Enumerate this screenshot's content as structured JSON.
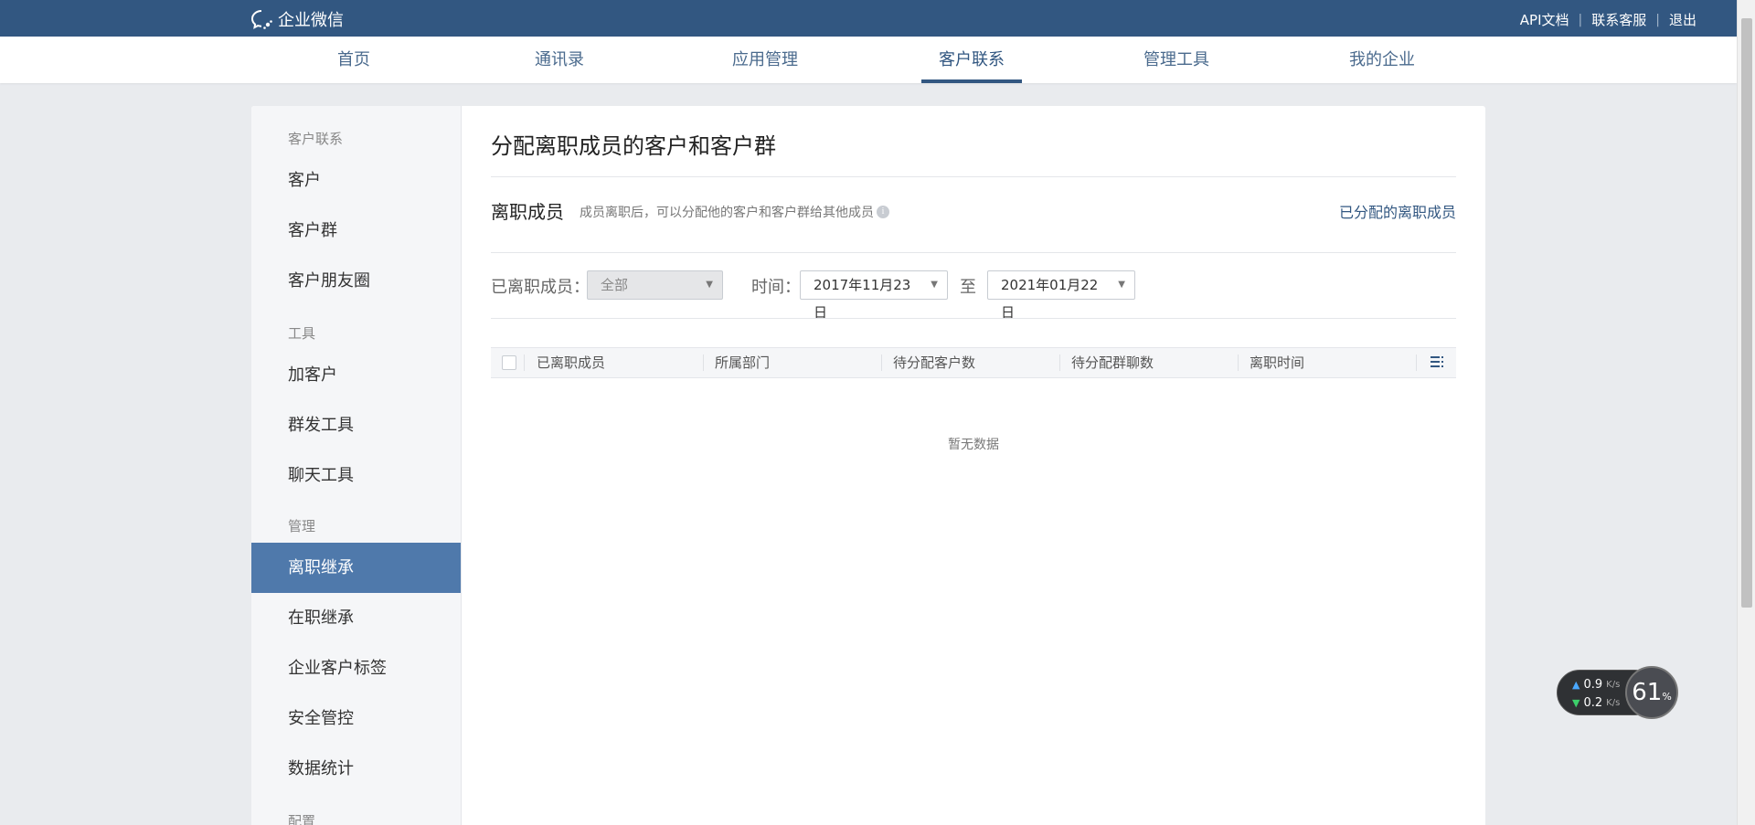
{
  "topbar": {
    "logo_text": "企业微信",
    "links": [
      "API文档",
      "联系客服",
      "退出"
    ]
  },
  "nav": {
    "items": [
      "首页",
      "通讯录",
      "应用管理",
      "客户联系",
      "管理工具",
      "我的企业"
    ],
    "active": "客户联系"
  },
  "sidebar": {
    "groups": [
      {
        "label": "客户联系",
        "items": [
          "客户",
          "客户群",
          "客户朋友圈"
        ]
      },
      {
        "label": "工具",
        "items": [
          "加客户",
          "群发工具",
          "聊天工具"
        ]
      },
      {
        "label": "管理",
        "items": [
          "离职继承",
          "在职继承",
          "企业客户标签",
          "安全管控",
          "数据统计"
        ]
      },
      {
        "label": "配置",
        "items": []
      }
    ],
    "active_item": "离职继承"
  },
  "main": {
    "title": "分配离职成员的客户和客户群",
    "section_title": "离职成员",
    "section_desc": "成员离职后，可以分配他的客户和客户群给其他成员",
    "assigned_link": "已分配的离职成员",
    "filters": {
      "member_label": "已离职成员：",
      "member_value": "全部",
      "time_label": "时间：",
      "start_date": "2017年11月23日",
      "to_label": "至",
      "end_date": "2021年01月22日"
    },
    "table": {
      "columns": [
        "已离职成员",
        "所属部门",
        "待分配客户数",
        "待分配群聊数",
        "离职时间"
      ],
      "rows": [],
      "empty_text": "暂无数据"
    }
  },
  "net_widget": {
    "upload": "0.9",
    "download": "0.2",
    "unit": "K/s",
    "percent": "61",
    "percent_sign": "%"
  },
  "colors": {
    "topbar": "#325781",
    "accent": "#4f79ab",
    "link": "#325781"
  }
}
